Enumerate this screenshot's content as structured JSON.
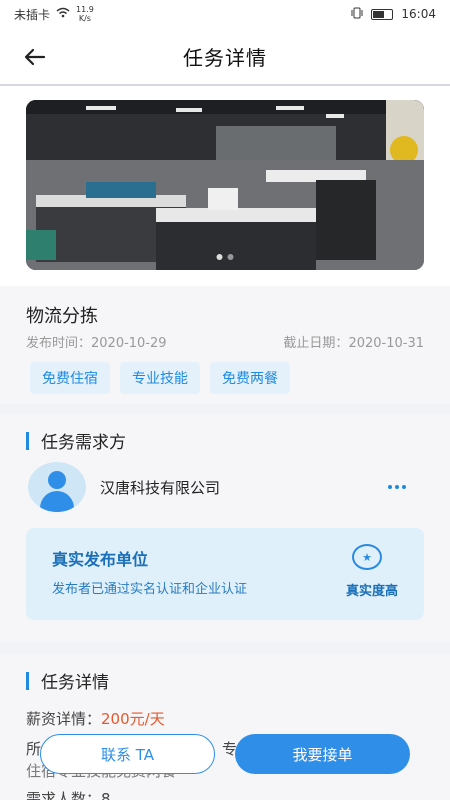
{
  "status_bar": {
    "carrier": "未插卡",
    "speed_value": "11.9",
    "speed_unit": "K/s",
    "time": "16:04"
  },
  "header": {
    "title": "任务详情",
    "back_icon": "arrow-left-icon"
  },
  "banner": {
    "image_icon": "office-photo",
    "slides": 2,
    "active_slide": 1
  },
  "job": {
    "name": "物流分拣",
    "publish_label": "发布时间：",
    "publish_date": "2020-10-29",
    "deadline_label": "截止日期：",
    "deadline_date": "2020-10-31",
    "tags": [
      "免费住宿",
      "专业技能",
      "免费两餐"
    ]
  },
  "requester": {
    "section_title": "任务需求方",
    "company_name": "汉唐科技有限公司",
    "verify": {
      "title": "真实发布单位",
      "description": "发布者已通过实名认证和企业认证",
      "level": "真实度高"
    }
  },
  "details": {
    "section_title": "任务详情",
    "salary_label": "薪资详情：",
    "salary_value": "200元/天",
    "line2_visible": "所",
    "line2_tail": "专业",
    "line3": "住宿专业技能免费两餐",
    "headcount_label": "需求人数：",
    "headcount_value": "8"
  },
  "actions": {
    "contact": "联系 TA",
    "accept": "我要接单"
  },
  "colors": {
    "accent": "#2f8fe8",
    "salary": "#e35a2c",
    "tag_bg": "#e4f1fb"
  }
}
